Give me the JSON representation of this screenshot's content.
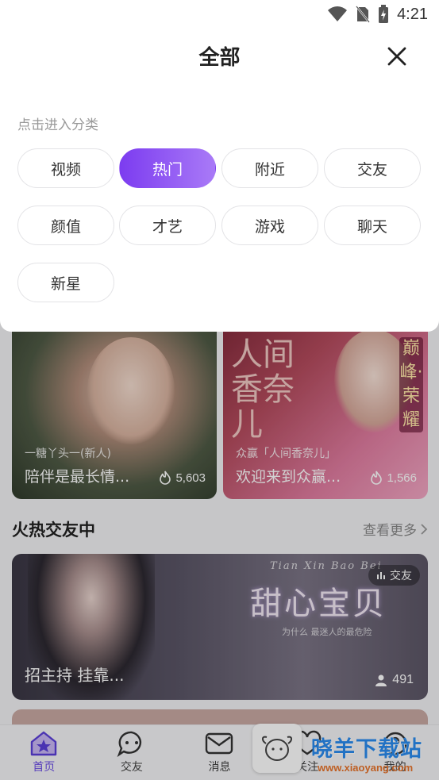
{
  "status_bar": {
    "time": "4:21"
  },
  "panel": {
    "title": "全部",
    "hint": "点击进入分类",
    "categories": [
      {
        "label": "视频",
        "selected": false
      },
      {
        "label": "热门",
        "selected": true
      },
      {
        "label": "附近",
        "selected": false
      },
      {
        "label": "交友",
        "selected": false
      },
      {
        "label": "颜值",
        "selected": false
      },
      {
        "label": "才艺",
        "selected": false
      },
      {
        "label": "游戏",
        "selected": false
      },
      {
        "label": "聊天",
        "selected": false
      },
      {
        "label": "新星",
        "selected": false
      }
    ]
  },
  "feed": {
    "cards": [
      {
        "subtitle": "一糖丫头一(新人)",
        "title": "陪伴是最长情...",
        "count": "5,603"
      },
      {
        "subtitle": "众赢「人间香奈儿」",
        "title": "欢迎来到众赢...",
        "count": "1,566",
        "poster_text": "人间香奈儿",
        "side_text": "巅峰·荣耀"
      }
    ],
    "section": {
      "title": "火热交友中",
      "more": "查看更多"
    },
    "banner": {
      "tag": "交友",
      "title": "招主持 挂靠...",
      "count": "491",
      "logo": "甜心宝贝",
      "script": "Tian Xin Bao Bei",
      "slogan": "为什么 最迷人的最危险"
    }
  },
  "bottom_nav": {
    "items": [
      {
        "label": "首页",
        "active": true
      },
      {
        "label": "交友",
        "active": false
      },
      {
        "label": "消息",
        "active": false
      },
      {
        "label": "关注",
        "active": false
      },
      {
        "label": "我的",
        "active": false
      }
    ]
  },
  "watermark": {
    "text": "晓羊下载站",
    "url": "www.xiaoyang.com"
  },
  "colors": {
    "accent": "#7c3cf0",
    "accent_light": "#a97af7",
    "nav_active": "#6c4de6"
  }
}
